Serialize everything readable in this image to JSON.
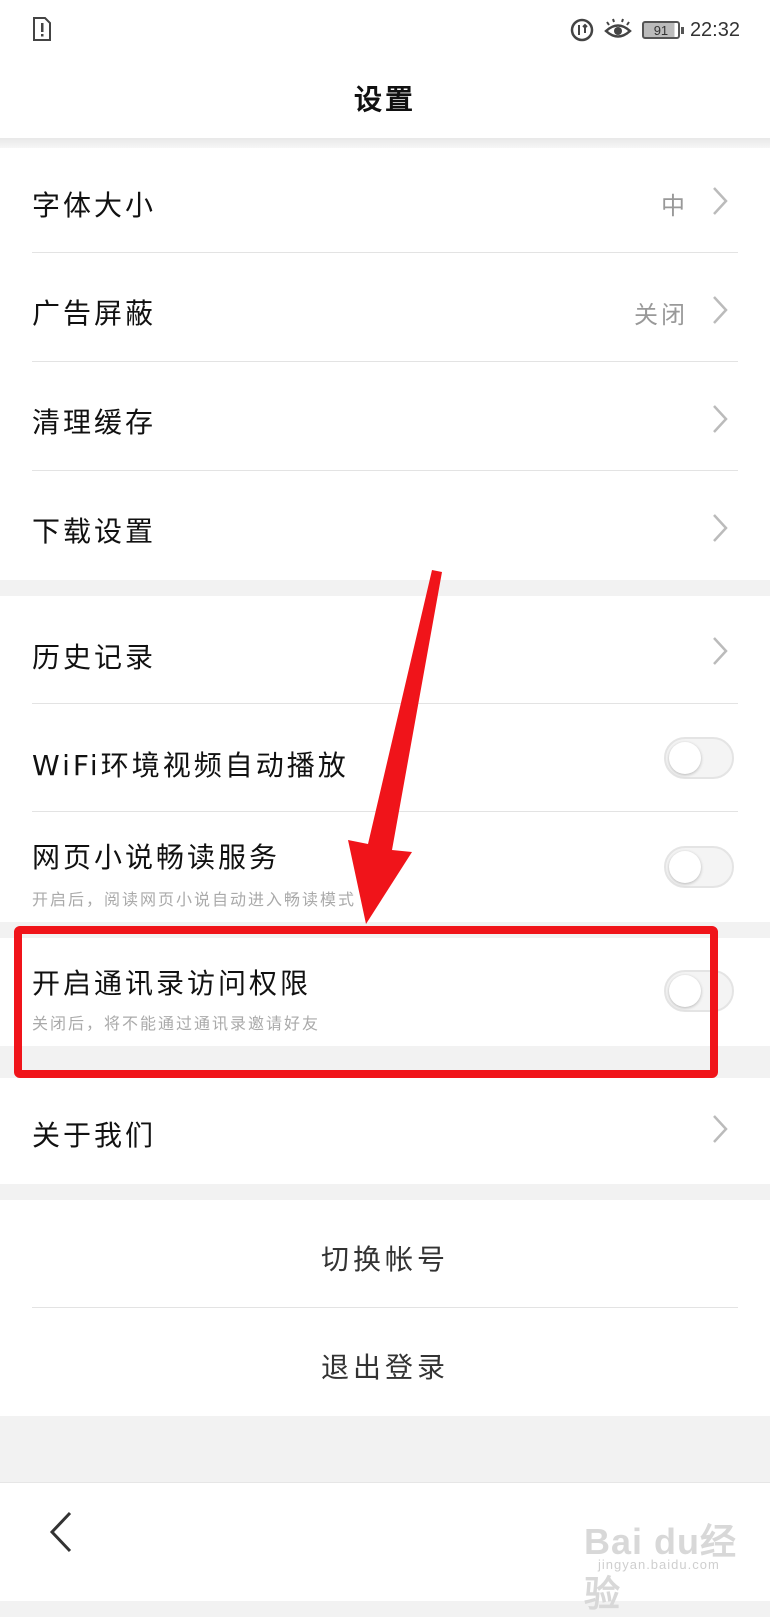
{
  "status_bar": {
    "time": "22:32",
    "battery": "91",
    "icons": [
      "sim-alert-icon",
      "data-saver-icon",
      "eye-care-icon",
      "battery-icon"
    ]
  },
  "title": "设置",
  "group1": [
    {
      "label": "字体大小",
      "value": "中",
      "control": "chevron"
    },
    {
      "label": "广告屏蔽",
      "value": "关闭",
      "control": "chevron"
    },
    {
      "label": "清理缓存",
      "value": "",
      "control": "chevron"
    },
    {
      "label": "下载设置",
      "value": "",
      "control": "chevron"
    }
  ],
  "group2": [
    {
      "label": "历史记录",
      "control": "chevron"
    },
    {
      "label": "WiFi环境视频自动播放",
      "control": "toggle",
      "on": false
    },
    {
      "label": "网页小说畅读服务",
      "sub": "开启后，阅读网页小说自动进入畅读模式",
      "control": "toggle",
      "on": false
    }
  ],
  "group3": [
    {
      "label": "开启通讯录访问权限",
      "sub": "关闭后，将不能通过通讯录邀请好友",
      "control": "toggle",
      "on": false
    }
  ],
  "group4": [
    {
      "label": "关于我们",
      "control": "chevron"
    }
  ],
  "account": {
    "switch_label": "切换帐号",
    "logout_label": "退出登录"
  },
  "watermark": {
    "brand": "Bai du经验",
    "url": "jingyan.baidu.com"
  },
  "colors": {
    "highlight": "#f0141a",
    "background": "#f2f2f2"
  }
}
